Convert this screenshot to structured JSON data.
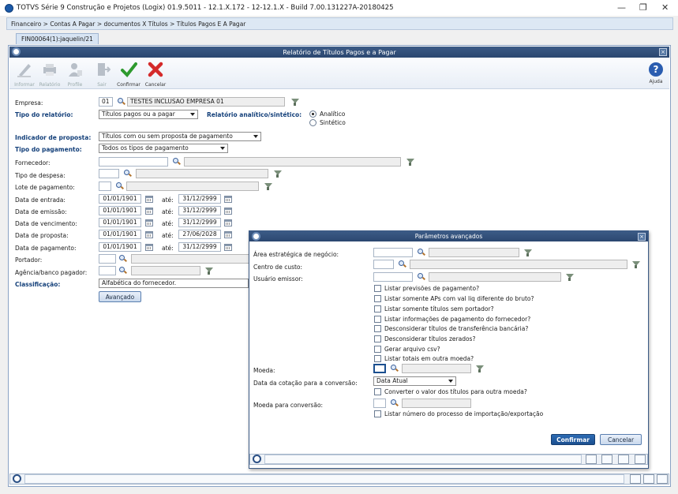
{
  "window": {
    "title": "TOTVS Série 9 Construção e Projetos (Logix) 01.9.5011  -  12.1.X.172 - 12-12.1.X - Build 7.00.131227A-20180425",
    "minimize": "—",
    "maximize": "❐",
    "close": "✕"
  },
  "breadcrumb": "Financeiro > Contas A Pagar > documentos X Títulos > Títulos Pagos E A Pagar",
  "tab": "FIN00064(1):jaquelin/21",
  "dialog": {
    "title": "Relatório de Títulos Pagos e a Pagar",
    "close": "×"
  },
  "toolbar": {
    "informar": "Informar",
    "relatorio": "Relatório",
    "propfile": "Proﬁle",
    "sair": "Sair",
    "confirmar": "Confirmar",
    "cancelar": "Cancelar",
    "ajuda": "Ajuda"
  },
  "form": {
    "empresa_label": "Empresa:",
    "empresa_code": "01",
    "empresa_name": "TESTES INCLUSAO EMPRESA 01",
    "tipo_relatorio_label": "Tipo do relatório:",
    "tipo_relatorio_value": "Títulos pagos ou a pagar",
    "analitico_label": "Relatório analítico/sintético:",
    "analitico_option": "Analítico",
    "sintetico_option": "Sintético",
    "indicador_label": "Indicador de proposta:",
    "indicador_value": "Títulos com ou sem proposta de pagamento",
    "tipo_pagamento_label": "Tipo do pagamento:",
    "tipo_pagamento_value": "Todos os tipos de pagamento",
    "fornecedor_label": "Fornecedor:",
    "tipo_despesa_label": "Tipo de despesa:",
    "lote_label": "Lote de pagamento:",
    "data_entrada_label": "Data de entrada:",
    "data_emissao_label": "Data de emissão:",
    "data_vencimento_label": "Data de vencimento:",
    "data_proposta_label": "Data de proposta:",
    "data_pagamento_label": "Data de pagamento:",
    "ate": "até:",
    "dates": [
      {
        "from": "01/01/1901",
        "to": "31/12/2999"
      },
      {
        "from": "01/01/1901",
        "to": "31/12/2999"
      },
      {
        "from": "01/01/1901",
        "to": "31/12/2999"
      },
      {
        "from": "01/01/1901",
        "to": "27/06/2028"
      },
      {
        "from": "01/01/1901",
        "to": "31/12/2999"
      }
    ],
    "portador_label": "Portador:",
    "agencia_label": "Agência/banco pagador:",
    "classificacao_label": "Classificação:",
    "classificacao_value": "Alfabética do fornecedor.",
    "avancado_button": "Avançado"
  },
  "advanced": {
    "title": "Parâmetros avançados",
    "close": "×",
    "area_label": "Área estratégica de negócio:",
    "centro_label": "Centro de custo:",
    "usuario_label": "Usuário emissor:",
    "checks": [
      "Listar previsões de pagamento?",
      "Listar somente APs com val liq diferente do bruto?",
      "Listar somente títulos sem portador?",
      "Listar informações de pagamento do fornecedor?",
      "Desconsiderar títulos de transferência bancária?",
      "Desconsiderar títulos zerados?",
      "Gerar arquivo csv?",
      "Listar totais em outra moeda?"
    ],
    "moeda_label": "Moeda:",
    "data_cotacao_label": "Data da cotação para a conversão:",
    "data_cotacao_value": "Data Atual",
    "converter_check": "Converter o valor dos títulos para outra moeda?",
    "moeda_conv_label": "Moeda para conversão:",
    "listar_numero_check": "Listar número do processo de importação/exportação",
    "confirmar_button": "Confirmar",
    "cancelar_button": "Cancelar"
  },
  "colors": {
    "title_bar": "#2b4770",
    "accent": "#1b4f8f",
    "confirm_green": "#2e9a2e",
    "cancel_red": "#d42a2a"
  }
}
